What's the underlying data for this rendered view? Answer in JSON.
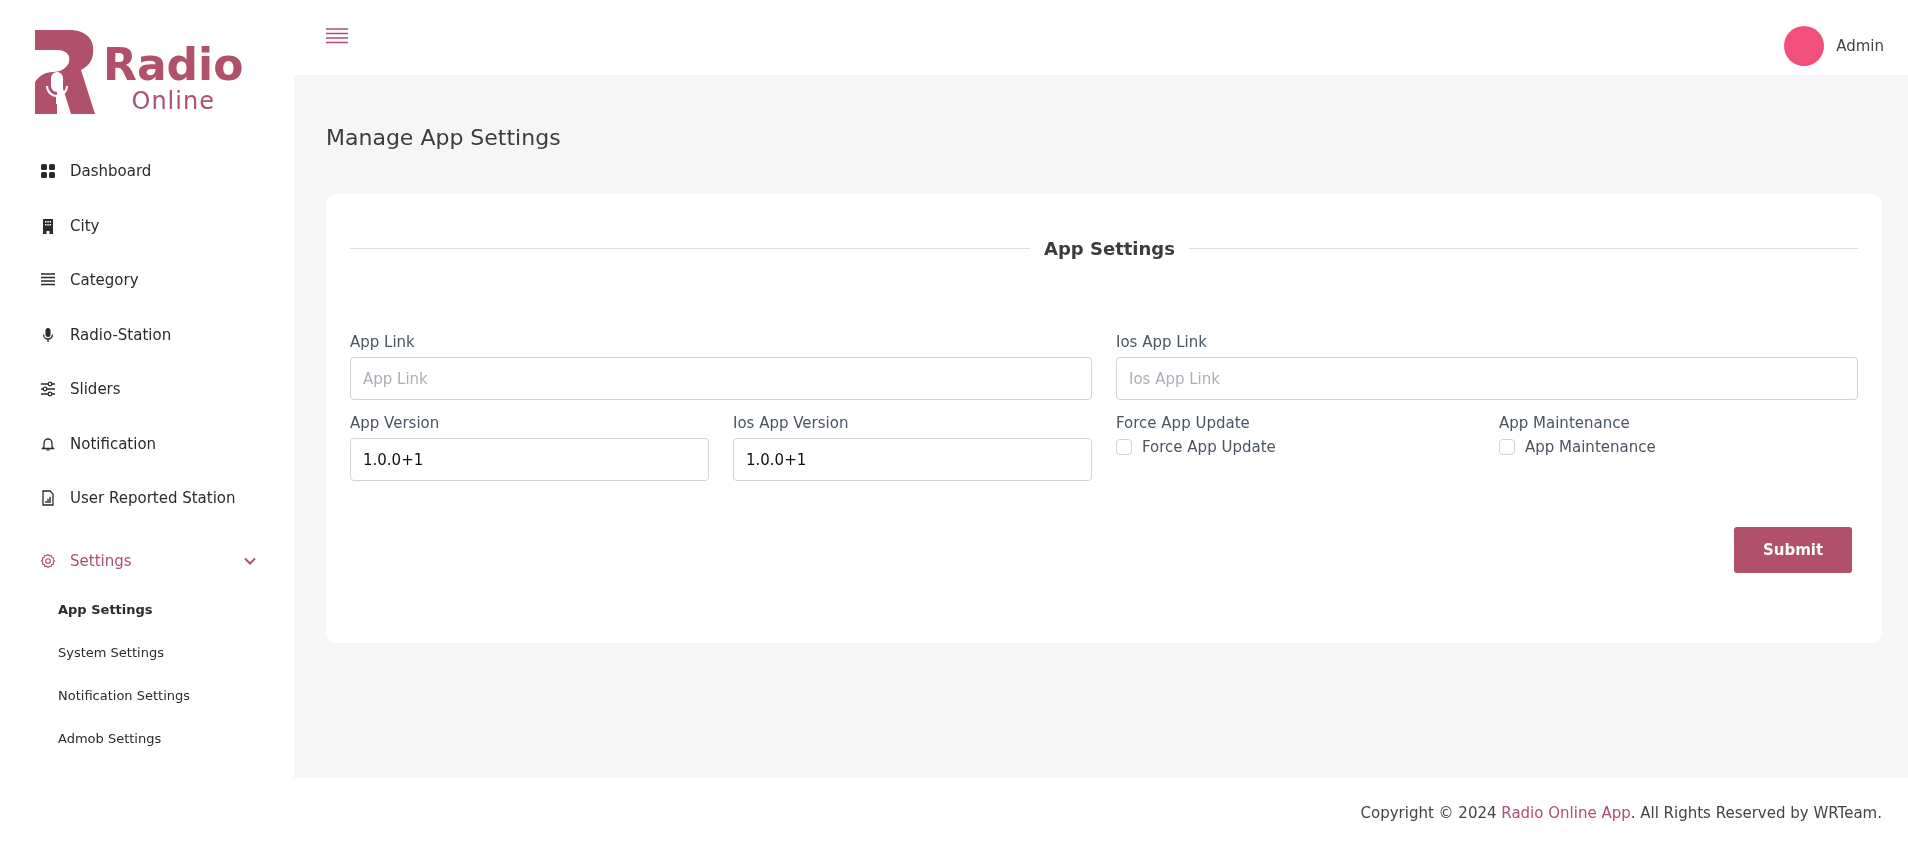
{
  "logo": {
    "title": "Radio",
    "subtitle": "Online"
  },
  "sidebar": {
    "items": [
      {
        "label": "Dashboard",
        "selected": false
      },
      {
        "label": "City",
        "selected": false
      },
      {
        "label": "Category",
        "selected": false
      },
      {
        "label": "Radio-Station",
        "selected": false
      },
      {
        "label": "Sliders",
        "selected": false
      },
      {
        "label": "Notification",
        "selected": false
      },
      {
        "label": "User Reported Station",
        "selected": false
      },
      {
        "label": "Settings",
        "selected": true,
        "expanded": true,
        "children": [
          {
            "label": "App Settings",
            "selected": true
          },
          {
            "label": "System Settings",
            "selected": false
          },
          {
            "label": "Notification Settings",
            "selected": false
          },
          {
            "label": "Admob Settings",
            "selected": false
          }
        ]
      }
    ]
  },
  "header": {
    "user": "Admin"
  },
  "page_title": "Manage App Settings",
  "card": {
    "legend": "App Settings",
    "fields": [
      {
        "kind": "text",
        "label": "App Link",
        "placeholder": "App Link"
      },
      {
        "kind": "text",
        "label": "Ios App Link",
        "placeholder": "Ios App Link"
      },
      {
        "kind": "text",
        "label": "App Version",
        "value": "1.0.0+1"
      },
      {
        "kind": "text",
        "label": "Ios App Version",
        "value": "1.0.0+1"
      },
      {
        "kind": "checkbox",
        "label": "Force App Update",
        "option": "Force App Update",
        "checked": false
      },
      {
        "kind": "checkbox",
        "label": "App Maintenance",
        "option": "App Maintenance",
        "checked": false
      }
    ],
    "submit": "Submit"
  },
  "footer": {
    "prefix": "Copyright © 2024 ",
    "link": "Radio Online App",
    "suffix": ". All Rights Reserved by WRTeam."
  }
}
